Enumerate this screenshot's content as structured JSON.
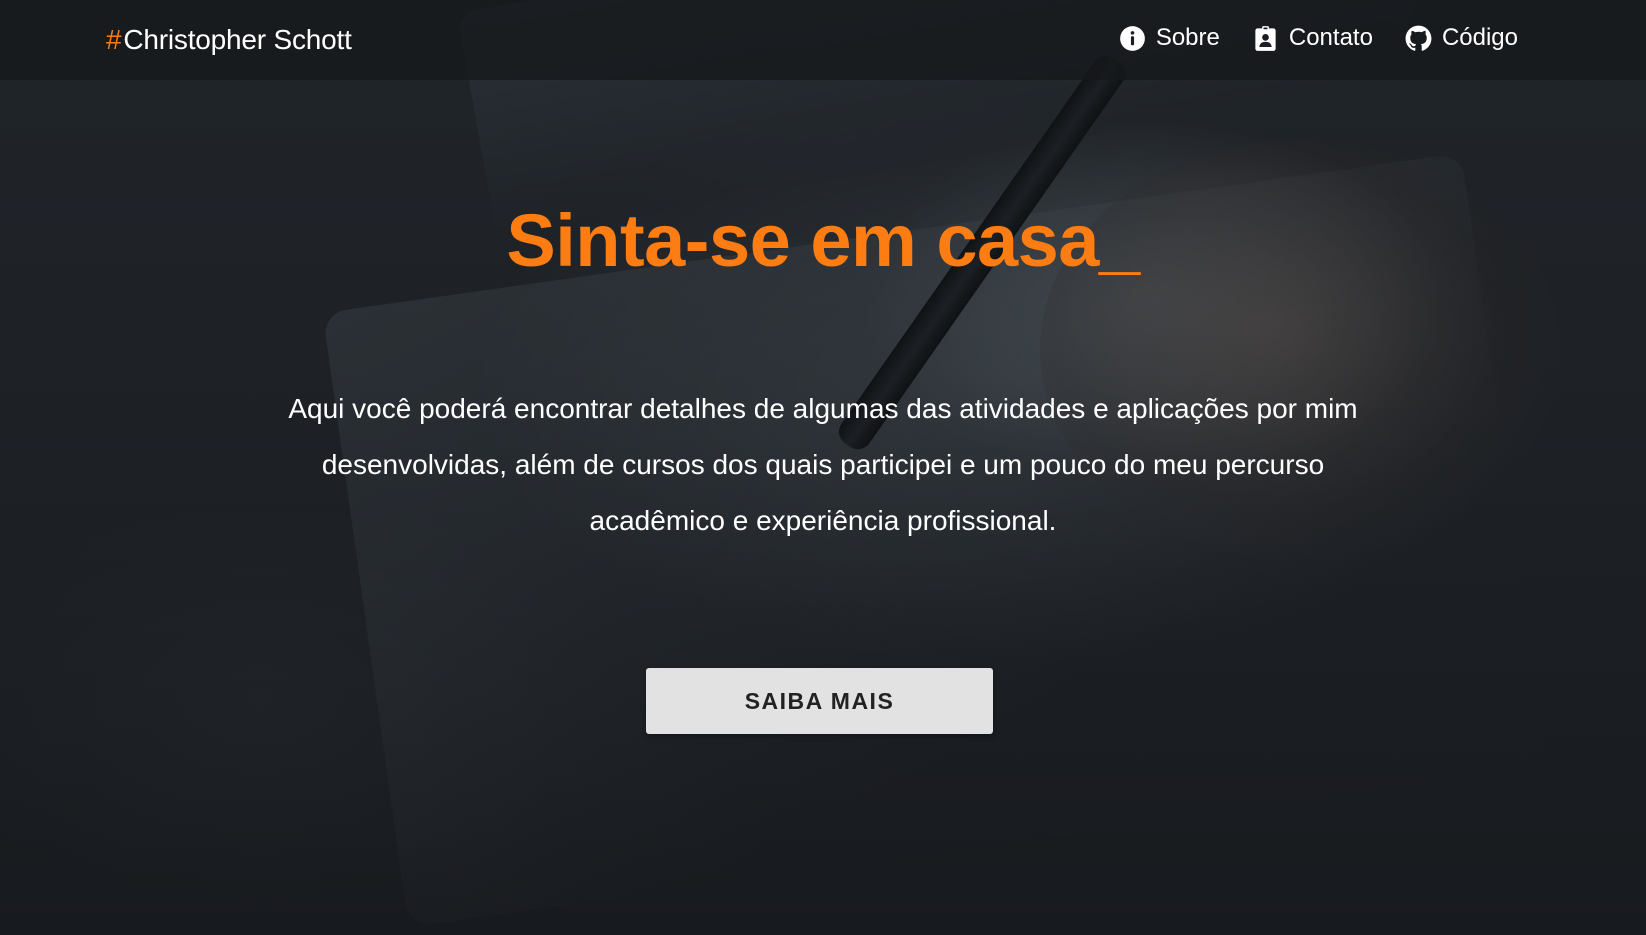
{
  "brand": {
    "hash": "#",
    "name": "Christopher Schott"
  },
  "nav": {
    "items": [
      {
        "label": "Sobre",
        "icon": "info-circle-icon"
      },
      {
        "label": "Contato",
        "icon": "contact-badge-icon"
      },
      {
        "label": "Código",
        "icon": "github-icon"
      }
    ]
  },
  "hero": {
    "title": "Sinta-se em casa_",
    "text": "Aqui você poderá encontrar detalhes de algumas das atividades e aplicações por mim desenvolvidas, além de cursos dos quais participei e um pouco do meu percurso acadêmico e experiência profissional.",
    "cta_label": "SAIBA MAIS"
  },
  "colors": {
    "accent": "#fd7d12",
    "text": "#ffffff",
    "button_bg": "#e2e2e2",
    "button_text": "#222222"
  }
}
